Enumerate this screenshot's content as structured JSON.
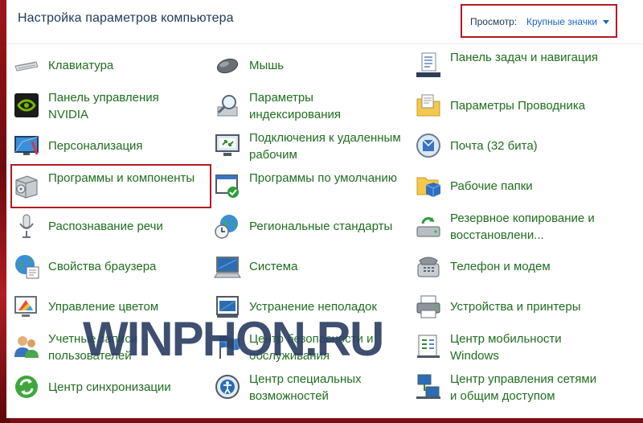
{
  "header": {
    "title": "Настройка параметров компьютера",
    "view_label": "Просмотр:",
    "view_value": "Крупные значки"
  },
  "items": [
    {
      "label": "Клавиатура",
      "icon": "keyboard-icon"
    },
    {
      "label": "Мышь",
      "icon": "mouse-icon"
    },
    {
      "label": "Панель задач и навигация",
      "icon": "taskbar-icon"
    },
    {
      "label": "Панель управления NVIDIA",
      "icon": "nvidia-icon"
    },
    {
      "label": "Параметры индексирования",
      "icon": "indexing-icon"
    },
    {
      "label": "Параметры Проводника",
      "icon": "folder-options-icon"
    },
    {
      "label": "Персонализация",
      "icon": "personalization-icon"
    },
    {
      "label": "Подключения к удаленным рабочим",
      "icon": "remote-connections-icon"
    },
    {
      "label": "Почта (32 бита)",
      "icon": "mail-icon"
    },
    {
      "label": "Программы и компоненты",
      "icon": "programs-icon"
    },
    {
      "label": "Программы по умолчанию",
      "icon": "default-programs-icon"
    },
    {
      "label": "Рабочие папки",
      "icon": "work-folders-icon"
    },
    {
      "label": "Распознавание речи",
      "icon": "microphone-icon"
    },
    {
      "label": "Региональные стандарты",
      "icon": "region-icon"
    },
    {
      "label": "Резервное копирование и восстановлени...",
      "icon": "backup-icon"
    },
    {
      "label": "Свойства браузера",
      "icon": "browser-icon"
    },
    {
      "label": "Система",
      "icon": "system-icon"
    },
    {
      "label": "Телефон и модем",
      "icon": "phone-icon"
    },
    {
      "label": "Управление цветом",
      "icon": "color-management-icon"
    },
    {
      "label": "Устранение неполадок",
      "icon": "troubleshooting-icon"
    },
    {
      "label": "Устройства и принтеры",
      "icon": "printer-icon"
    },
    {
      "label": "Учетные записи пользователей",
      "icon": "users-icon"
    },
    {
      "label": "Центр безопасности и обслуживания",
      "icon": "security-flag-icon"
    },
    {
      "label": "Центр мобильности Windows",
      "icon": "mobility-icon"
    },
    {
      "label": "Центр синхронизации",
      "icon": "sync-icon"
    },
    {
      "label": "Центр специальных возможностей",
      "icon": "accessibility-icon"
    },
    {
      "label": "Центр управления сетями и общим доступом",
      "icon": "network-icon"
    }
  ],
  "watermark": "WINPHON.RU"
}
